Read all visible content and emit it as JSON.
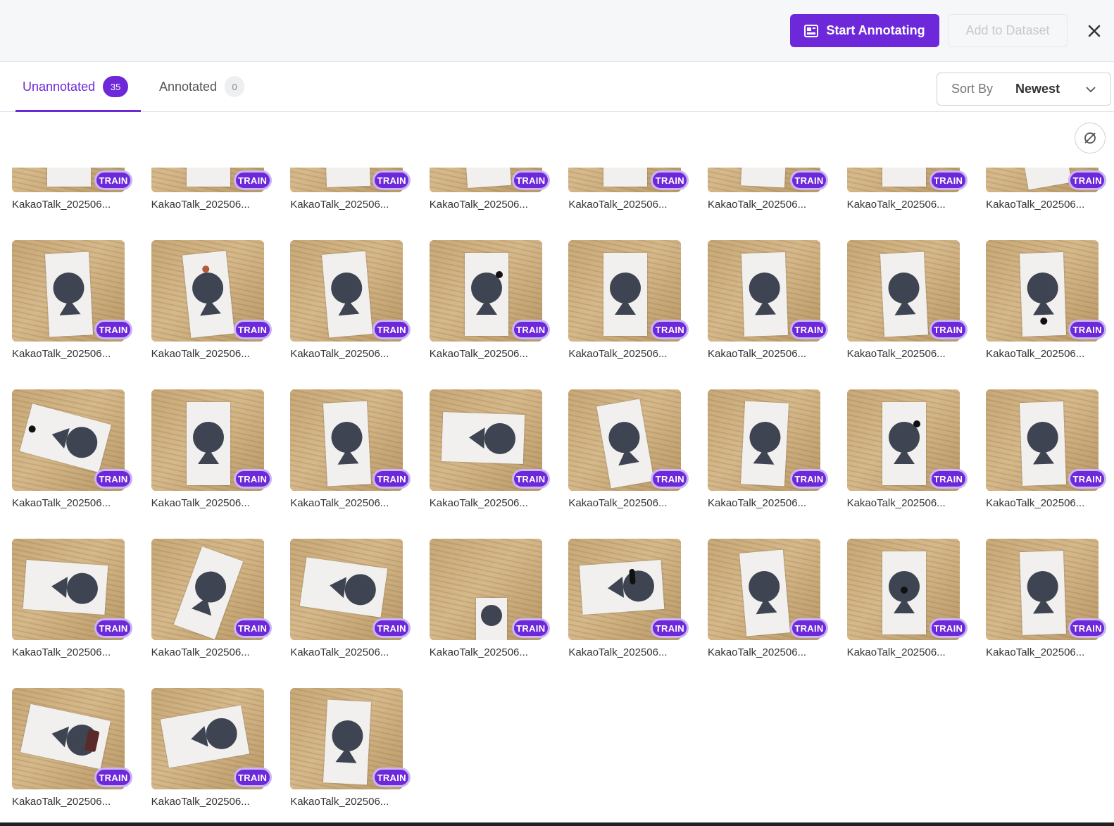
{
  "header": {
    "start_annotating_label": "Start Annotating",
    "add_to_dataset_label": "Add to Dataset",
    "accent_color": "#6d28d9"
  },
  "tabs": [
    {
      "label": "Unannotated",
      "count": "35"
    },
    {
      "label": "Annotated",
      "count": "0"
    }
  ],
  "sort": {
    "label": "Sort By",
    "value": "Newest"
  },
  "images": [
    {
      "name": "KakaoTalk_202506...",
      "split": "TRAIN"
    },
    {
      "name": "KakaoTalk_202506...",
      "split": "TRAIN"
    },
    {
      "name": "KakaoTalk_202506...",
      "split": "TRAIN"
    },
    {
      "name": "KakaoTalk_202506...",
      "split": "TRAIN"
    },
    {
      "name": "KakaoTalk_202506...",
      "split": "TRAIN"
    },
    {
      "name": "KakaoTalk_202506...",
      "split": "TRAIN"
    },
    {
      "name": "KakaoTalk_202506...",
      "split": "TRAIN"
    },
    {
      "name": "KakaoTalk_202506...",
      "split": "TRAIN"
    },
    {
      "name": "KakaoTalk_202506...",
      "split": "TRAIN"
    },
    {
      "name": "KakaoTalk_202506...",
      "split": "TRAIN"
    },
    {
      "name": "KakaoTalk_202506...",
      "split": "TRAIN"
    },
    {
      "name": "KakaoTalk_202506...",
      "split": "TRAIN"
    },
    {
      "name": "KakaoTalk_202506...",
      "split": "TRAIN"
    },
    {
      "name": "KakaoTalk_202506...",
      "split": "TRAIN"
    },
    {
      "name": "KakaoTalk_202506...",
      "split": "TRAIN"
    },
    {
      "name": "KakaoTalk_202506...",
      "split": "TRAIN"
    },
    {
      "name": "KakaoTalk_202506...",
      "split": "TRAIN"
    },
    {
      "name": "KakaoTalk_202506...",
      "split": "TRAIN"
    },
    {
      "name": "KakaoTalk_202506...",
      "split": "TRAIN"
    },
    {
      "name": "KakaoTalk_202506...",
      "split": "TRAIN"
    },
    {
      "name": "KakaoTalk_202506...",
      "split": "TRAIN"
    },
    {
      "name": "KakaoTalk_202506...",
      "split": "TRAIN"
    },
    {
      "name": "KakaoTalk_202506...",
      "split": "TRAIN"
    },
    {
      "name": "KakaoTalk_202506...",
      "split": "TRAIN"
    },
    {
      "name": "KakaoTalk_202506...",
      "split": "TRAIN"
    },
    {
      "name": "KakaoTalk_202506...",
      "split": "TRAIN"
    },
    {
      "name": "KakaoTalk_202506...",
      "split": "TRAIN"
    },
    {
      "name": "KakaoTalk_202506...",
      "split": "TRAIN"
    },
    {
      "name": "KakaoTalk_202506...",
      "split": "TRAIN"
    },
    {
      "name": "KakaoTalk_202506...",
      "split": "TRAIN"
    },
    {
      "name": "KakaoTalk_202506...",
      "split": "TRAIN"
    },
    {
      "name": "KakaoTalk_202506...",
      "split": "TRAIN"
    },
    {
      "name": "KakaoTalk_202506...",
      "split": "TRAIN"
    },
    {
      "name": "KakaoTalk_202506...",
      "split": "TRAIN"
    },
    {
      "name": "KakaoTalk_202506...",
      "split": "TRAIN"
    }
  ]
}
